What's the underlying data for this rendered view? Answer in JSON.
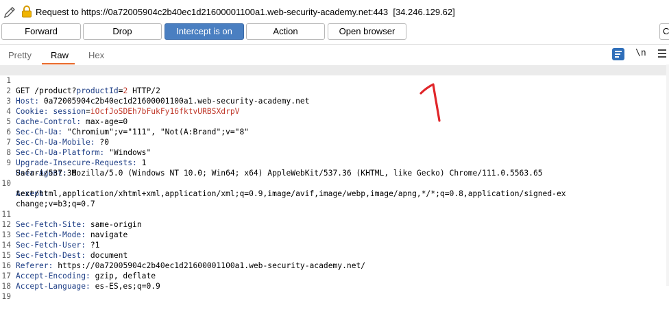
{
  "header": {
    "request_prefix": "Request to ",
    "host_url": "https://0a72005904c2b40ec1d21600001100a1.web-security-academy.net:443",
    "ip": "[34.246.129.62]"
  },
  "toolbar": {
    "forward_label": "Forward",
    "drop_label": "Drop",
    "intercept_label": "Intercept is on",
    "action_label": "Action",
    "open_browser_label": "Open browser",
    "search_stub": "C"
  },
  "tabs": {
    "pretty": "Pretty",
    "raw": "Raw",
    "hex": "Hex",
    "active": "Raw"
  },
  "editor_icons": {
    "newline_label": "\\n"
  },
  "colors": {
    "accent": "#4a7fc1",
    "tab_underline": "#e8692a",
    "header_key": "#1f3f86",
    "value_red": "#c0392b"
  },
  "request": {
    "line1": {
      "num": "1",
      "method": "GET /product?",
      "param_key": "productId",
      "eq": "=",
      "param_val": "2",
      "rest": " HTTP/2"
    },
    "line2": {
      "num": "2",
      "key": "Host:",
      "value": " 0a72005904c2b40ec1d21600001100a1.web-security-academy.net"
    },
    "line3": {
      "num": "3",
      "key": "Cookie:",
      "ckey": " session",
      "ceq": "=",
      "cval": "iOcfJoSDEh7bFukFy16fktvURBSXdrpV"
    },
    "line4": {
      "num": "4",
      "key": "Cache-Control:",
      "value": " max-age=0"
    },
    "line5": {
      "num": "5",
      "key": "Sec-Ch-Ua:",
      "value": " \"Chromium\";v=\"111\", \"Not(A:Brand\";v=\"8\""
    },
    "line6": {
      "num": "6",
      "key": "Sec-Ch-Ua-Mobile:",
      "value": " ?0"
    },
    "line7": {
      "num": "7",
      "key": "Sec-Ch-Ua-Platform:",
      "value": " \"Windows\""
    },
    "line8": {
      "num": "8",
      "key": "Upgrade-Insecure-Requests:",
      "value": " 1"
    },
    "line9": {
      "num": "9",
      "key": "User-Agent:",
      "value": " Mozilla/5.0 (Windows NT 10.0; Win64; x64) AppleWebKit/537.36 (KHTML, like Gecko) Chrome/111.0.5563.65"
    },
    "line9b": {
      "value": "Safari/537.36"
    },
    "line10": {
      "num": "10",
      "key": "Accept:"
    },
    "line10b": {
      "value": "text/html,application/xhtml+xml,application/xml;q=0.9,image/avif,image/webp,image/apng,*/*;q=0.8,application/signed-ex"
    },
    "line10c": {
      "value": "change;v=b3;q=0.7"
    },
    "line11": {
      "num": "11",
      "key": "Sec-Fetch-Site:",
      "value": " same-origin"
    },
    "line12": {
      "num": "12",
      "key": "Sec-Fetch-Mode:",
      "value": " navigate"
    },
    "line13": {
      "num": "13",
      "key": "Sec-Fetch-User:",
      "value": " ?1"
    },
    "line14": {
      "num": "14",
      "key": "Sec-Fetch-Dest:",
      "value": " document"
    },
    "line15": {
      "num": "15",
      "key": "Referer:",
      "value": " https://0a72005904c2b40ec1d21600001100a1.web-security-academy.net/"
    },
    "line16": {
      "num": "16",
      "key": "Accept-Encoding:",
      "value": " gzip, deflate"
    },
    "line17": {
      "num": "17",
      "key": "Accept-Language:",
      "value": " es-ES,es;q=0.9"
    },
    "line18": {
      "num": "18"
    },
    "line19": {
      "num": "19"
    }
  },
  "annotation": {
    "shape": "handwritten-number-one",
    "color": "#e0262a"
  }
}
